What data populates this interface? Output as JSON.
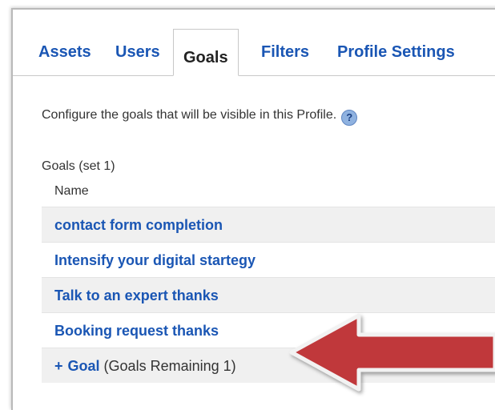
{
  "tabs": [
    {
      "label": "Assets"
    },
    {
      "label": "Users"
    },
    {
      "label": "Goals",
      "active": true
    },
    {
      "label": "Filters"
    },
    {
      "label": "Profile Settings"
    }
  ],
  "description": "Configure the goals that will be visible in this Profile.",
  "help_icon": "?",
  "goal_set": {
    "title": "Goals (set 1)",
    "column_header": "Name",
    "goals": [
      {
        "name": "contact form completion"
      },
      {
        "name": "Intensify your digital startegy"
      },
      {
        "name": "Talk to an expert thanks"
      },
      {
        "name": "Booking request thanks"
      }
    ],
    "add_goal": {
      "plus": "+",
      "link_label": "Goal",
      "remaining_text": "(Goals Remaining 1)"
    }
  },
  "colors": {
    "link": "#1a56b4",
    "arrow": "#c0393b",
    "row_shade": "#f0f0f0"
  },
  "icons": [
    "help-icon",
    "annotation-arrow"
  ]
}
